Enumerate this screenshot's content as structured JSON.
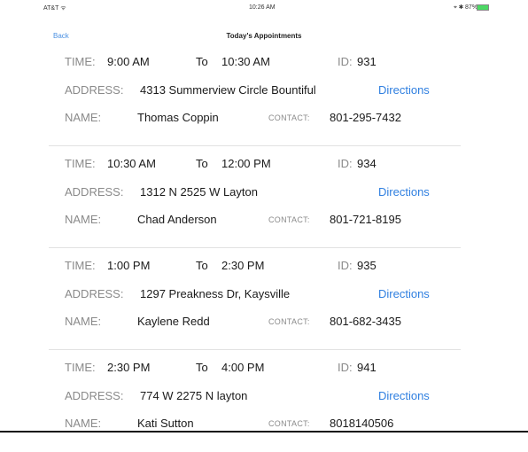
{
  "status_bar": {
    "carrier": "AT&T ᯤ",
    "time": "10:26 AM",
    "battery": "⌖ ✱ 87%"
  },
  "nav": {
    "back_label": "Back",
    "title": "Today's Appointments"
  },
  "labels": {
    "time": "TIME:",
    "to": "To",
    "id": "ID:",
    "address": "ADDRESS:",
    "name": "NAME:",
    "contact": "CONTACT:",
    "directions": "Directions"
  },
  "appointments": [
    {
      "start": "9:00 AM",
      "end": "10:30 AM",
      "id": "931",
      "address": "4313 Summerview Circle Bountiful",
      "name": "Thomas Coppin",
      "contact": "801-295-7432"
    },
    {
      "start": "10:30 AM",
      "end": "12:00 PM",
      "id": "934",
      "address": "1312 N 2525 W Layton",
      "name": "Chad Anderson",
      "contact": "801-721-8195"
    },
    {
      "start": "1:00 PM",
      "end": "2:30 PM",
      "id": "935",
      "address": "1297 Preakness Dr,  Kaysville",
      "name": "Kaylene Redd",
      "contact": "801-682-3435"
    },
    {
      "start": "2:30 PM",
      "end": "4:00 PM",
      "id": "941",
      "address": "774 W 2275 N layton",
      "name": "Kati Sutton",
      "contact": "8018140506"
    }
  ],
  "colors": {
    "accent": "#2f7fe0",
    "label": "#8a8a8a",
    "separator": "#e1e1e1"
  }
}
